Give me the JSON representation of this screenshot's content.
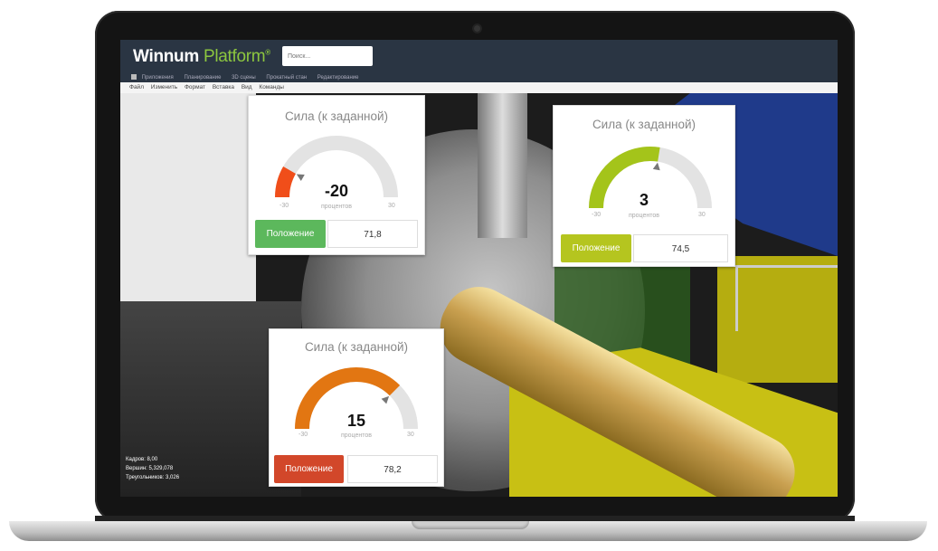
{
  "app": {
    "logo_main": "Winnum",
    "logo_accent": "Platform",
    "logo_mark": "®",
    "search_placeholder": "Поиск..."
  },
  "breadcrumb": [
    "Приложения",
    "Планирование",
    "3D сцены",
    "Прокатный стан",
    "Редактирование"
  ],
  "menu": [
    "Файл",
    "Изменить",
    "Формат",
    "Вставка",
    "Вид",
    "Команды"
  ],
  "scene_stats": [
    "Кадров: 8,00",
    "Вершин: 5,329,078",
    "Треугольников: 3,026"
  ],
  "widgets": [
    {
      "title": "Сила (к заданной)",
      "value": "-20",
      "value_num": -20,
      "unit": "процентов",
      "min": "-30",
      "max": "30",
      "gauge_color": "#f04e1a",
      "button_label": "Положение",
      "button_color": "#5cb85c",
      "position": "71,8"
    },
    {
      "title": "Сила (к заданной)",
      "value": "3",
      "value_num": 3,
      "unit": "процентов",
      "min": "-30",
      "max": "30",
      "gauge_color": "#a4c41a",
      "button_label": "Положение",
      "button_color": "#b5c51f",
      "position": "74,5"
    },
    {
      "title": "Сила (к заданной)",
      "value": "15",
      "value_num": 15,
      "unit": "процентов",
      "min": "-30",
      "max": "30",
      "gauge_color": "#e27612",
      "button_label": "Положение",
      "button_color": "#d2472a",
      "position": "78,2"
    }
  ]
}
